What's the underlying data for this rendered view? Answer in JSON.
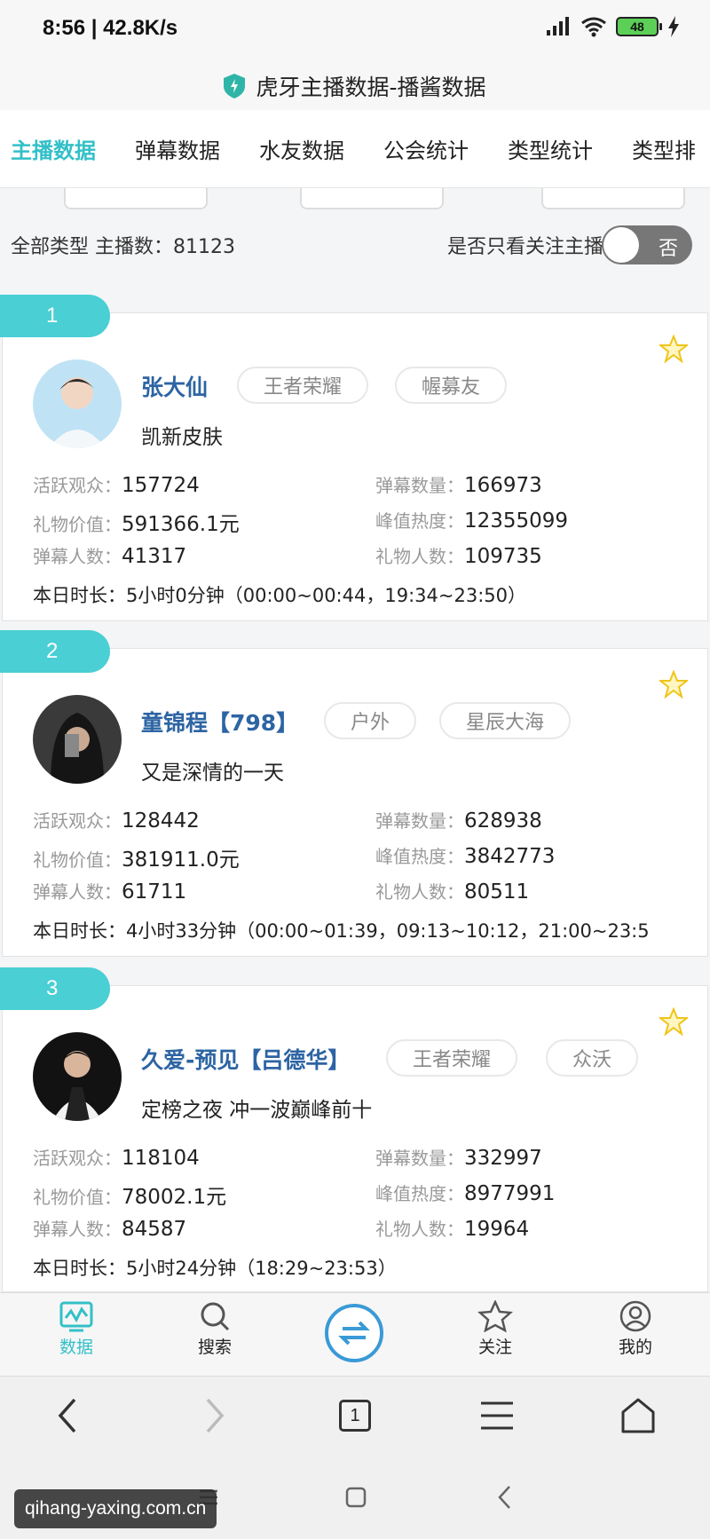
{
  "status_bar": {
    "time": "8:56 | 42.8K/s",
    "battery": "48"
  },
  "title": "虎牙主播数据-播酱数据",
  "tabs": [
    "主播数据",
    "弹幕数据",
    "水友数据",
    "公会统计",
    "类型统计",
    "类型排"
  ],
  "summary": {
    "count_label": "全部类型 主播数：81123",
    "follow_only_label": "是否只看关注主播",
    "toggle_label": "否"
  },
  "stat_labels": {
    "active_viewers": "活跃观众：",
    "danmaku_count": "弹幕数量：",
    "gift_value": "礼物价值：",
    "peak_heat": "峰值热度：",
    "danmaku_users": "弹幕人数：",
    "gift_users": "礼物人数："
  },
  "streamers": [
    {
      "rank": "1",
      "name": "张大仙",
      "tags": [
        "王者荣耀",
        "幄募友"
      ],
      "desc": "凯新皮肤",
      "active_viewers": "157724",
      "danmaku_count": "166973",
      "gift_value": "591366.1元",
      "peak_heat": "12355099",
      "danmaku_users": "41317",
      "gift_users": "109735",
      "duration": "本日时长：5小时0分钟（00:00~00:44，19:34~23:50）"
    },
    {
      "rank": "2",
      "name": "童锦程【798】",
      "tags": [
        "户外",
        "星辰大海"
      ],
      "desc": "又是深情的一天",
      "active_viewers": "128442",
      "danmaku_count": "628938",
      "gift_value": "381911.0元",
      "peak_heat": "3842773",
      "danmaku_users": "61711",
      "gift_users": "80511",
      "duration": "本日时长：4小时33分钟（00:00~01:39，09:13~10:12，21:00~23:5"
    },
    {
      "rank": "3",
      "name": "久爱-预见【吕德华】",
      "tags": [
        "王者荣耀",
        "众沃"
      ],
      "desc": "定榜之夜 冲一波巅峰前十",
      "active_viewers": "118104",
      "danmaku_count": "332997",
      "gift_value": "78002.1元",
      "peak_heat": "8977991",
      "danmaku_users": "84587",
      "gift_users": "19964",
      "duration": "本日时长：5小时24分钟（18:29~23:53）"
    }
  ],
  "app_nav": {
    "data": "数据",
    "search": "搜索",
    "follow": "关注",
    "mine": "我的"
  },
  "browser": {
    "tab_count": "1"
  },
  "watermark": "qihang-yaxing.com.cn",
  "colors": {
    "accent": "#33c0c8",
    "rank_badge": "#49cfd4",
    "name": "#2d64a3"
  }
}
